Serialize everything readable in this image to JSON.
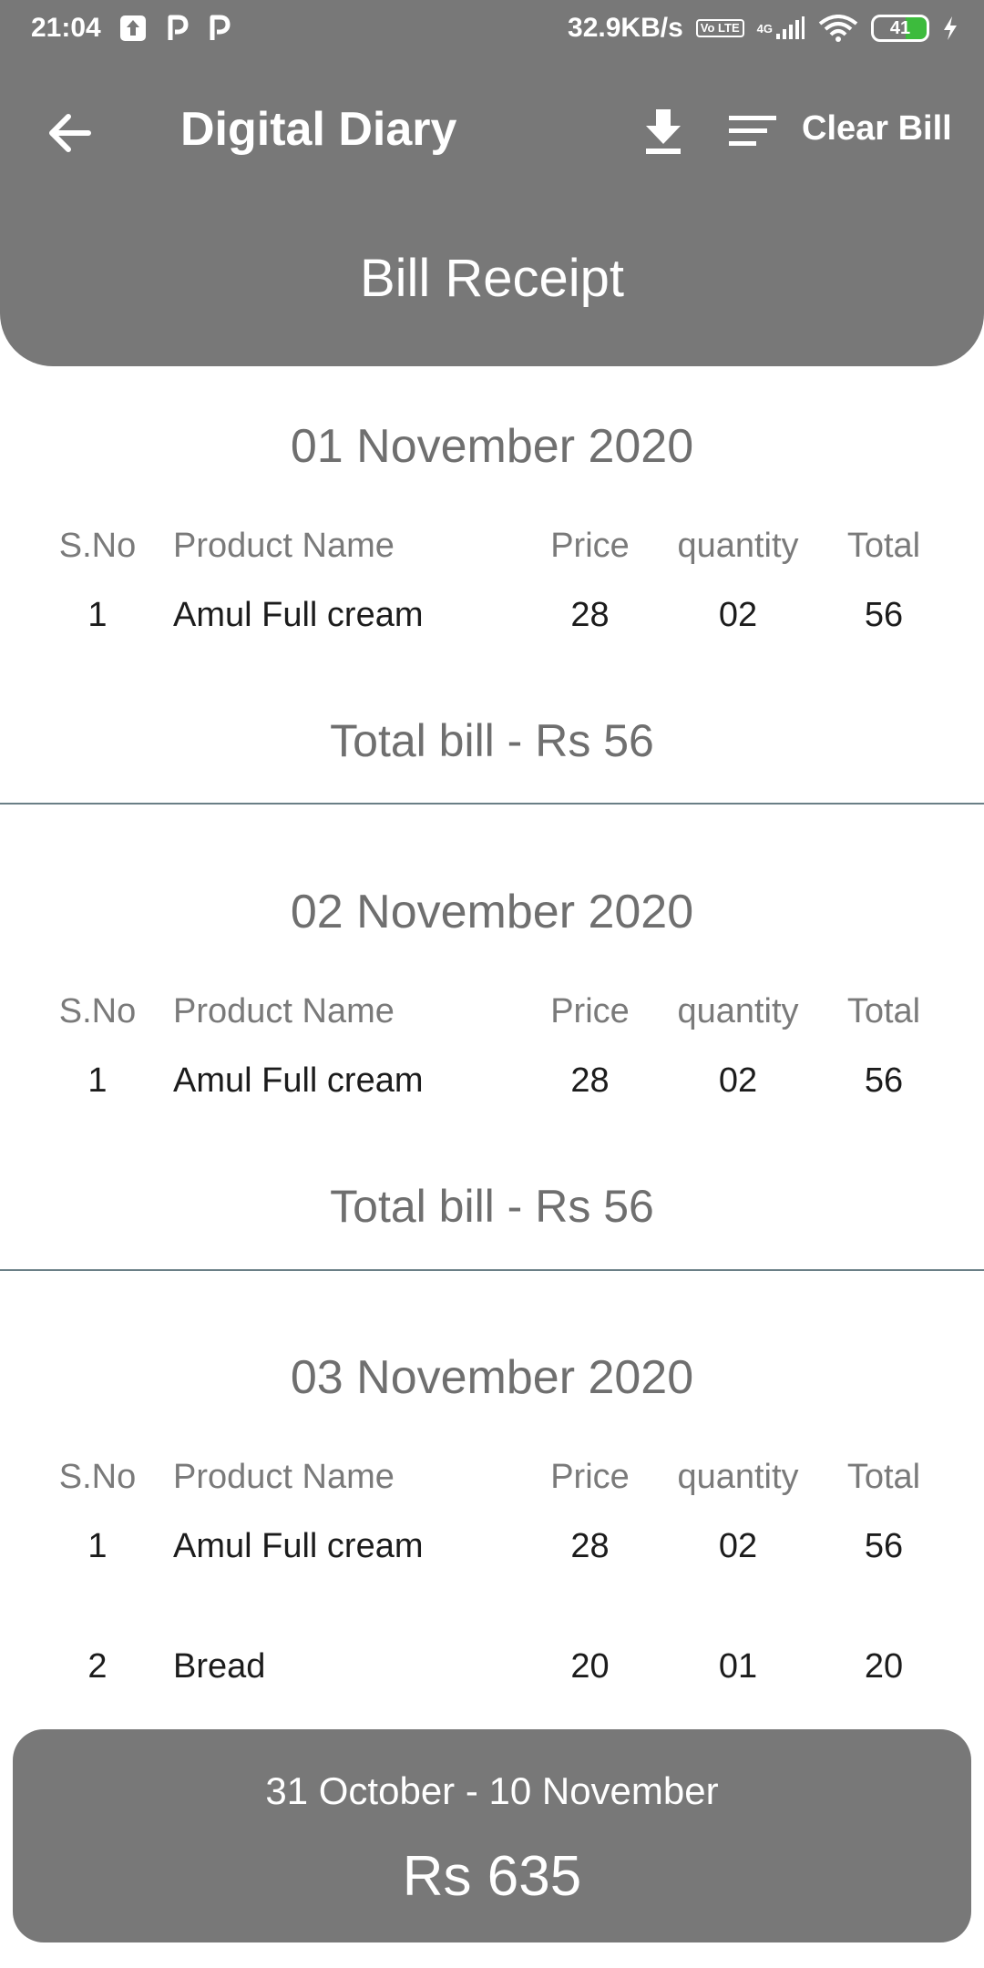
{
  "status_bar": {
    "time": "21:04",
    "speed": "32.9KB/s",
    "volte": "Vo LTE",
    "network": "4G",
    "battery": "41"
  },
  "app_bar": {
    "title": "Digital Diary",
    "clear_label": "Clear Bill",
    "icons": [
      "arrow-back-icon",
      "download-icon",
      "sort-icon"
    ]
  },
  "header": {
    "title": "Bill Receipt"
  },
  "table_headers": {
    "sno": "S.No",
    "name": "Product Name",
    "price": "Price",
    "qty": "quantity",
    "total": "Total"
  },
  "bills": [
    {
      "date": "01 November 2020",
      "items": [
        {
          "sno": "1",
          "name": "Amul Full cream",
          "price": "28",
          "qty": "02",
          "total": "56"
        }
      ],
      "total_text": "Total bill - Rs 56"
    },
    {
      "date": "02 November 2020",
      "items": [
        {
          "sno": "1",
          "name": "Amul Full cream",
          "price": "28",
          "qty": "02",
          "total": "56"
        }
      ],
      "total_text": "Total bill - Rs 56"
    },
    {
      "date": "03 November 2020",
      "items": [
        {
          "sno": "1",
          "name": "Amul Full cream",
          "price": "28",
          "qty": "02",
          "total": "56"
        },
        {
          "sno": "2",
          "name": "Bread",
          "price": "20",
          "qty": "01",
          "total": "20"
        }
      ]
    }
  ],
  "summary": {
    "range": "31 October - 10 November",
    "amount": "Rs 635"
  },
  "colors": {
    "header_bg": "#787878",
    "divider": "#6a7f86",
    "battery_fill": "#3dbb3d"
  }
}
